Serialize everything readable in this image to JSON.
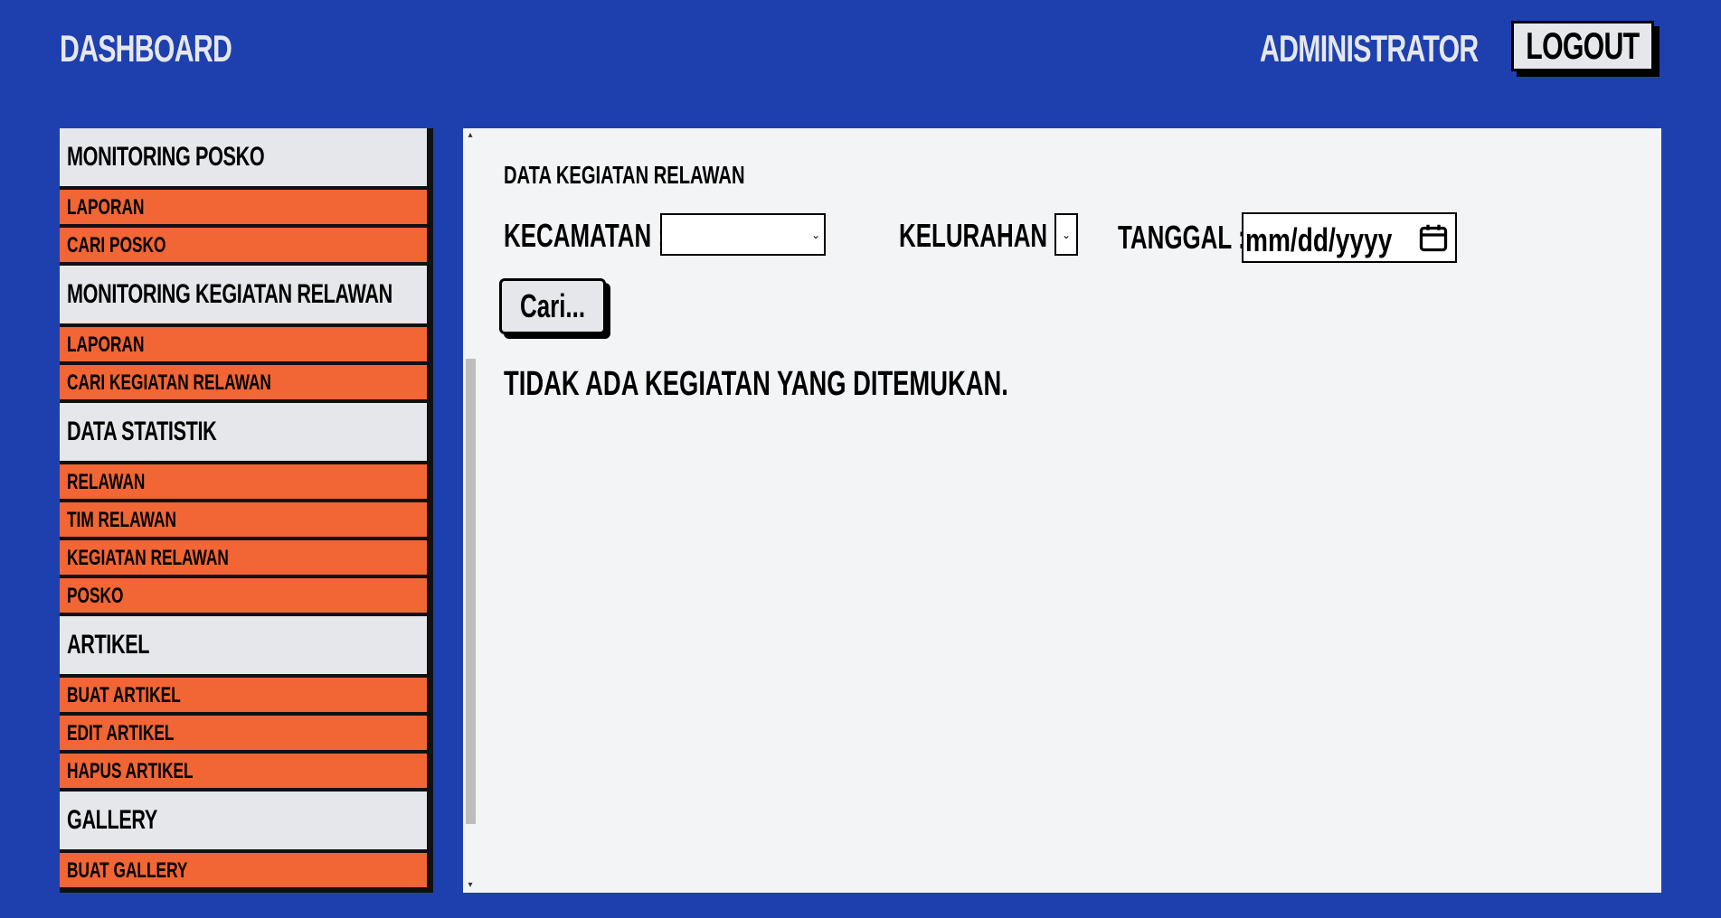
{
  "header": {
    "brand": "DASHBOARD",
    "user": "ADMINISTRATOR",
    "logout_label": "LOGOUT"
  },
  "sidebar": {
    "sections": [
      {
        "title": "MONITORING POSKO",
        "items": [
          "LAPORAN",
          "CARI POSKO"
        ]
      },
      {
        "title": "MONITORING KEGIATAN RELAWAN",
        "items": [
          "LAPORAN",
          "CARI KEGIATAN RELAWAN"
        ]
      },
      {
        "title": "DATA STATISTIK",
        "items": [
          "RELAWAN",
          "TIM RELAWAN",
          "KEGIATAN RELAWAN",
          "POSKO"
        ]
      },
      {
        "title": "ARTIKEL",
        "items": [
          "BUAT ARTIKEL",
          "EDIT ARTIKEL",
          "HAPUS ARTIKEL"
        ]
      },
      {
        "title": "GALLERY",
        "items": [
          "BUAT GALLERY"
        ]
      }
    ]
  },
  "main": {
    "title": "DATA KEGIATAN RELAWAN",
    "filters": {
      "kecamatan_label": "KECAMATAN :",
      "kecamatan_value": "",
      "kelurahan_label": "KELURAHAN :",
      "kelurahan_value": "",
      "tanggal_label": "TANGGAL :",
      "tanggal_placeholder": "mm/dd/yyyy"
    },
    "search_button": "Cari...",
    "empty_message": "TIDAK ADA KEGIATAN YANG DITEMUKAN."
  },
  "colors": {
    "background": "#1e40af",
    "sidebar_header": "#e5e7eb",
    "sidebar_item": "#f26535",
    "panel": "#f3f4f6"
  },
  "icons": {
    "calendar": "calendar-icon",
    "dropdown": "chevron-down-icon"
  }
}
